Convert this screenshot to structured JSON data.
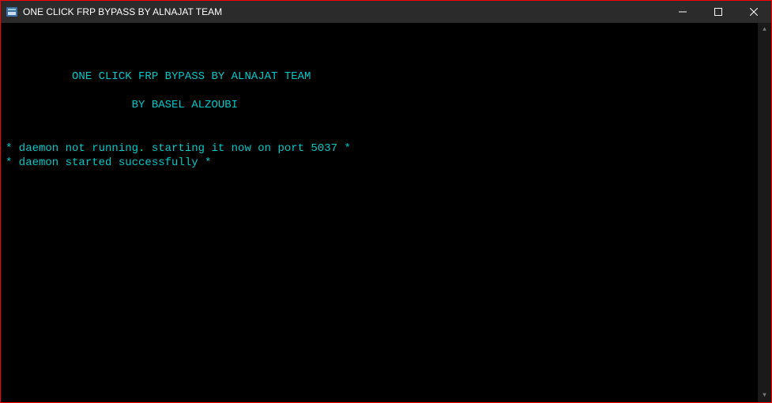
{
  "window": {
    "title": "ONE CLICK FRP BYPASS BY ALNAJAT TEAM"
  },
  "console": {
    "heading": "          ONE CLICK FRP BYPASS BY ALNAJAT TEAM",
    "subheading": "                   BY BASEL ALZOUBI",
    "lines": [
      "* daemon not running. starting it now on port 5037 *",
      "* daemon started successfully *"
    ]
  }
}
